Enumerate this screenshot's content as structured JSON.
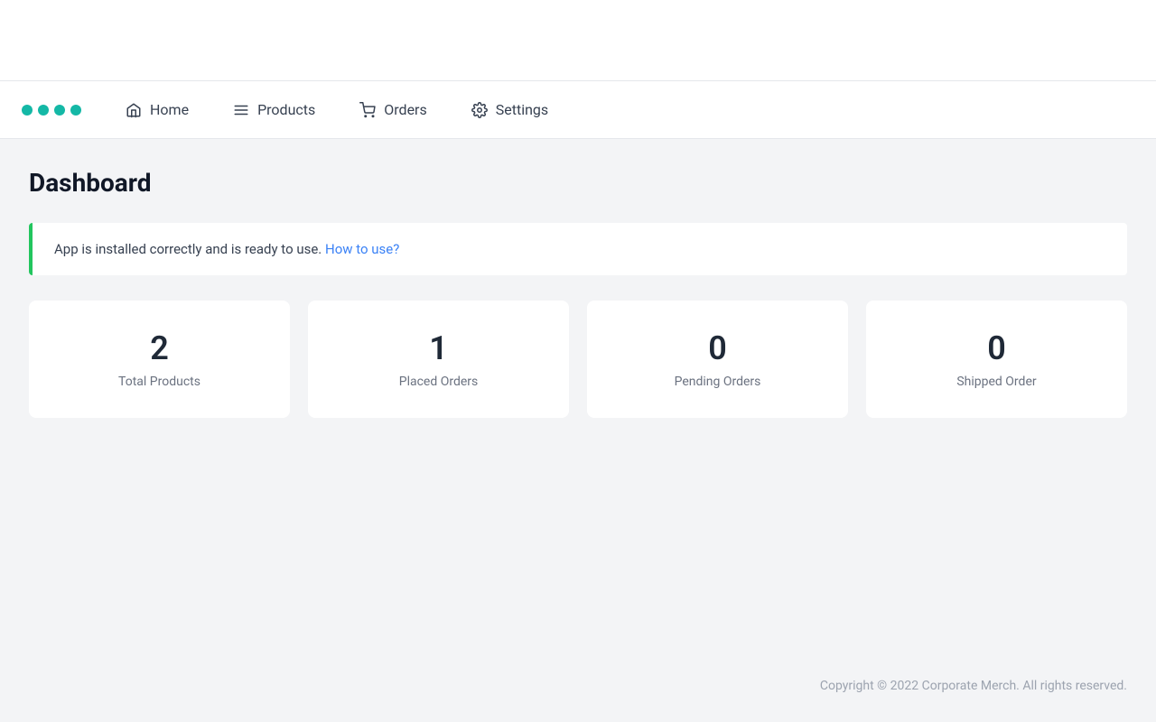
{
  "topbar": {},
  "navbar": {
    "dots": [
      {
        "color": "#14b8a6"
      },
      {
        "color": "#14b8a6"
      },
      {
        "color": "#14b8a6"
      },
      {
        "color": "#14b8a6"
      }
    ],
    "items": [
      {
        "label": "Home",
        "icon": "home"
      },
      {
        "label": "Products",
        "icon": "list"
      },
      {
        "label": "Orders",
        "icon": "cart"
      },
      {
        "label": "Settings",
        "icon": "gear"
      }
    ]
  },
  "main": {
    "title": "Dashboard",
    "banner": {
      "text": "App is installed correctly and is ready to use.",
      "link_label": "How to use?",
      "link_href": "#"
    },
    "stats": [
      {
        "number": "2",
        "label": "Total Products"
      },
      {
        "number": "1",
        "label": "Placed Orders"
      },
      {
        "number": "0",
        "label": "Pending Orders"
      },
      {
        "number": "0",
        "label": "Shipped Order"
      }
    ]
  },
  "footer": {
    "text": "Copyright © 2022 Corporate Merch. All rights reserved."
  }
}
